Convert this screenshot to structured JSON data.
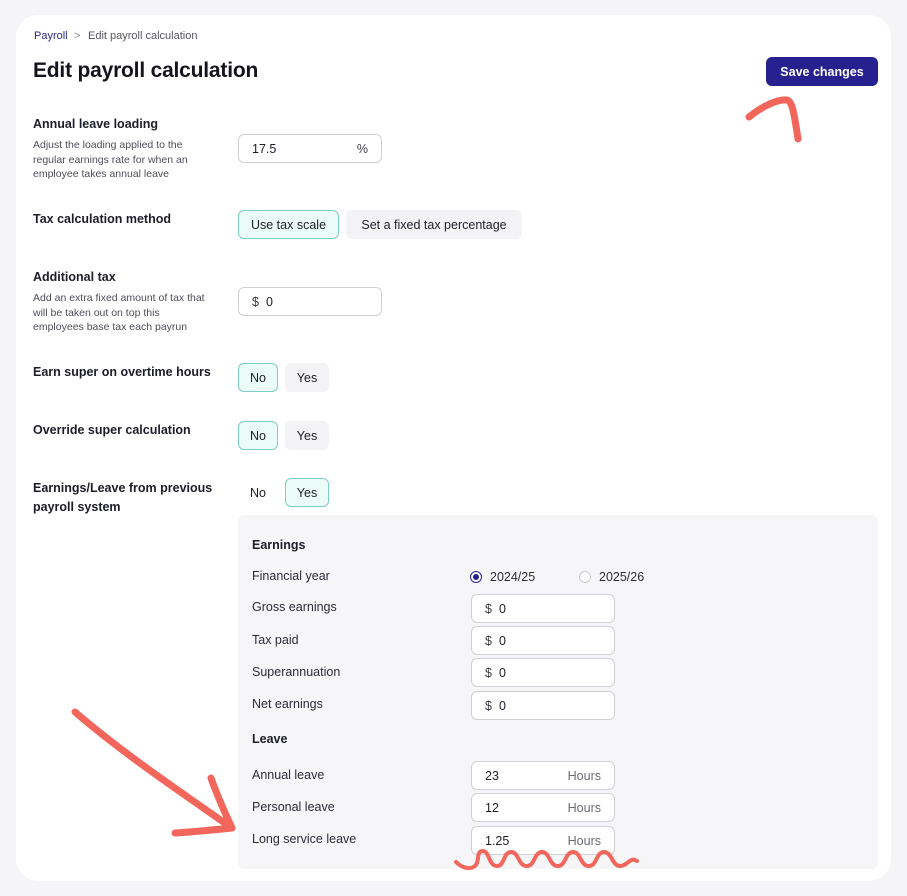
{
  "breadcrumb": {
    "parent": "Payroll",
    "separator": ">",
    "current": "Edit payroll calculation"
  },
  "page": {
    "title": "Edit payroll calculation",
    "save_label": "Save changes"
  },
  "annual_leave_loading": {
    "label": "Annual leave loading",
    "description": "Adjust the loading applied to the regular earnings rate for when an employee takes annual leave",
    "value": "17.5",
    "suffix": "%"
  },
  "tax_method": {
    "label": "Tax calculation method",
    "options": [
      "Use tax scale",
      "Set a fixed tax percentage"
    ],
    "selected": "Use tax scale"
  },
  "additional_tax": {
    "label": "Additional tax",
    "description": "Add an extra fixed amount of tax that will be taken out on top this employees base tax each payrun",
    "prefix": "$",
    "value": "0"
  },
  "super_overtime": {
    "label": "Earn super on overtime hours",
    "options": [
      "No",
      "Yes"
    ],
    "selected": "No"
  },
  "override_super": {
    "label": "Override super calculation",
    "options": [
      "No",
      "Yes"
    ],
    "selected": "No"
  },
  "previous_system": {
    "label": "Earnings/Leave from previous payroll system",
    "options": [
      "No",
      "Yes"
    ],
    "selected": "Yes"
  },
  "earnings": {
    "heading": "Earnings",
    "financial_year": {
      "label": "Financial year",
      "options": [
        "2024/25",
        "2025/26"
      ],
      "selected": "2024/25"
    },
    "rows": [
      {
        "label": "Gross earnings",
        "prefix": "$",
        "value": "0"
      },
      {
        "label": "Tax paid",
        "prefix": "$",
        "value": "0"
      },
      {
        "label": "Superannuation",
        "prefix": "$",
        "value": "0"
      },
      {
        "label": "Net earnings",
        "prefix": "$",
        "value": "0"
      }
    ]
  },
  "leave": {
    "heading": "Leave",
    "rows": [
      {
        "label": "Annual leave",
        "value": "23",
        "suffix": "Hours"
      },
      {
        "label": "Personal leave",
        "value": "12",
        "suffix": "Hours"
      },
      {
        "label": "Long service leave",
        "value": "1.25",
        "suffix": "Hours"
      }
    ]
  },
  "colors": {
    "primary": "#26218f",
    "selected_bg": "#eafbf8",
    "selected_border": "#7ccfc3",
    "annotation": "#f2665b"
  },
  "icons": {
    "breadcrumb_separator": "chevron-right-icon",
    "radio_selected": "radio-checked-icon",
    "radio_unselected": "radio-empty-icon"
  }
}
